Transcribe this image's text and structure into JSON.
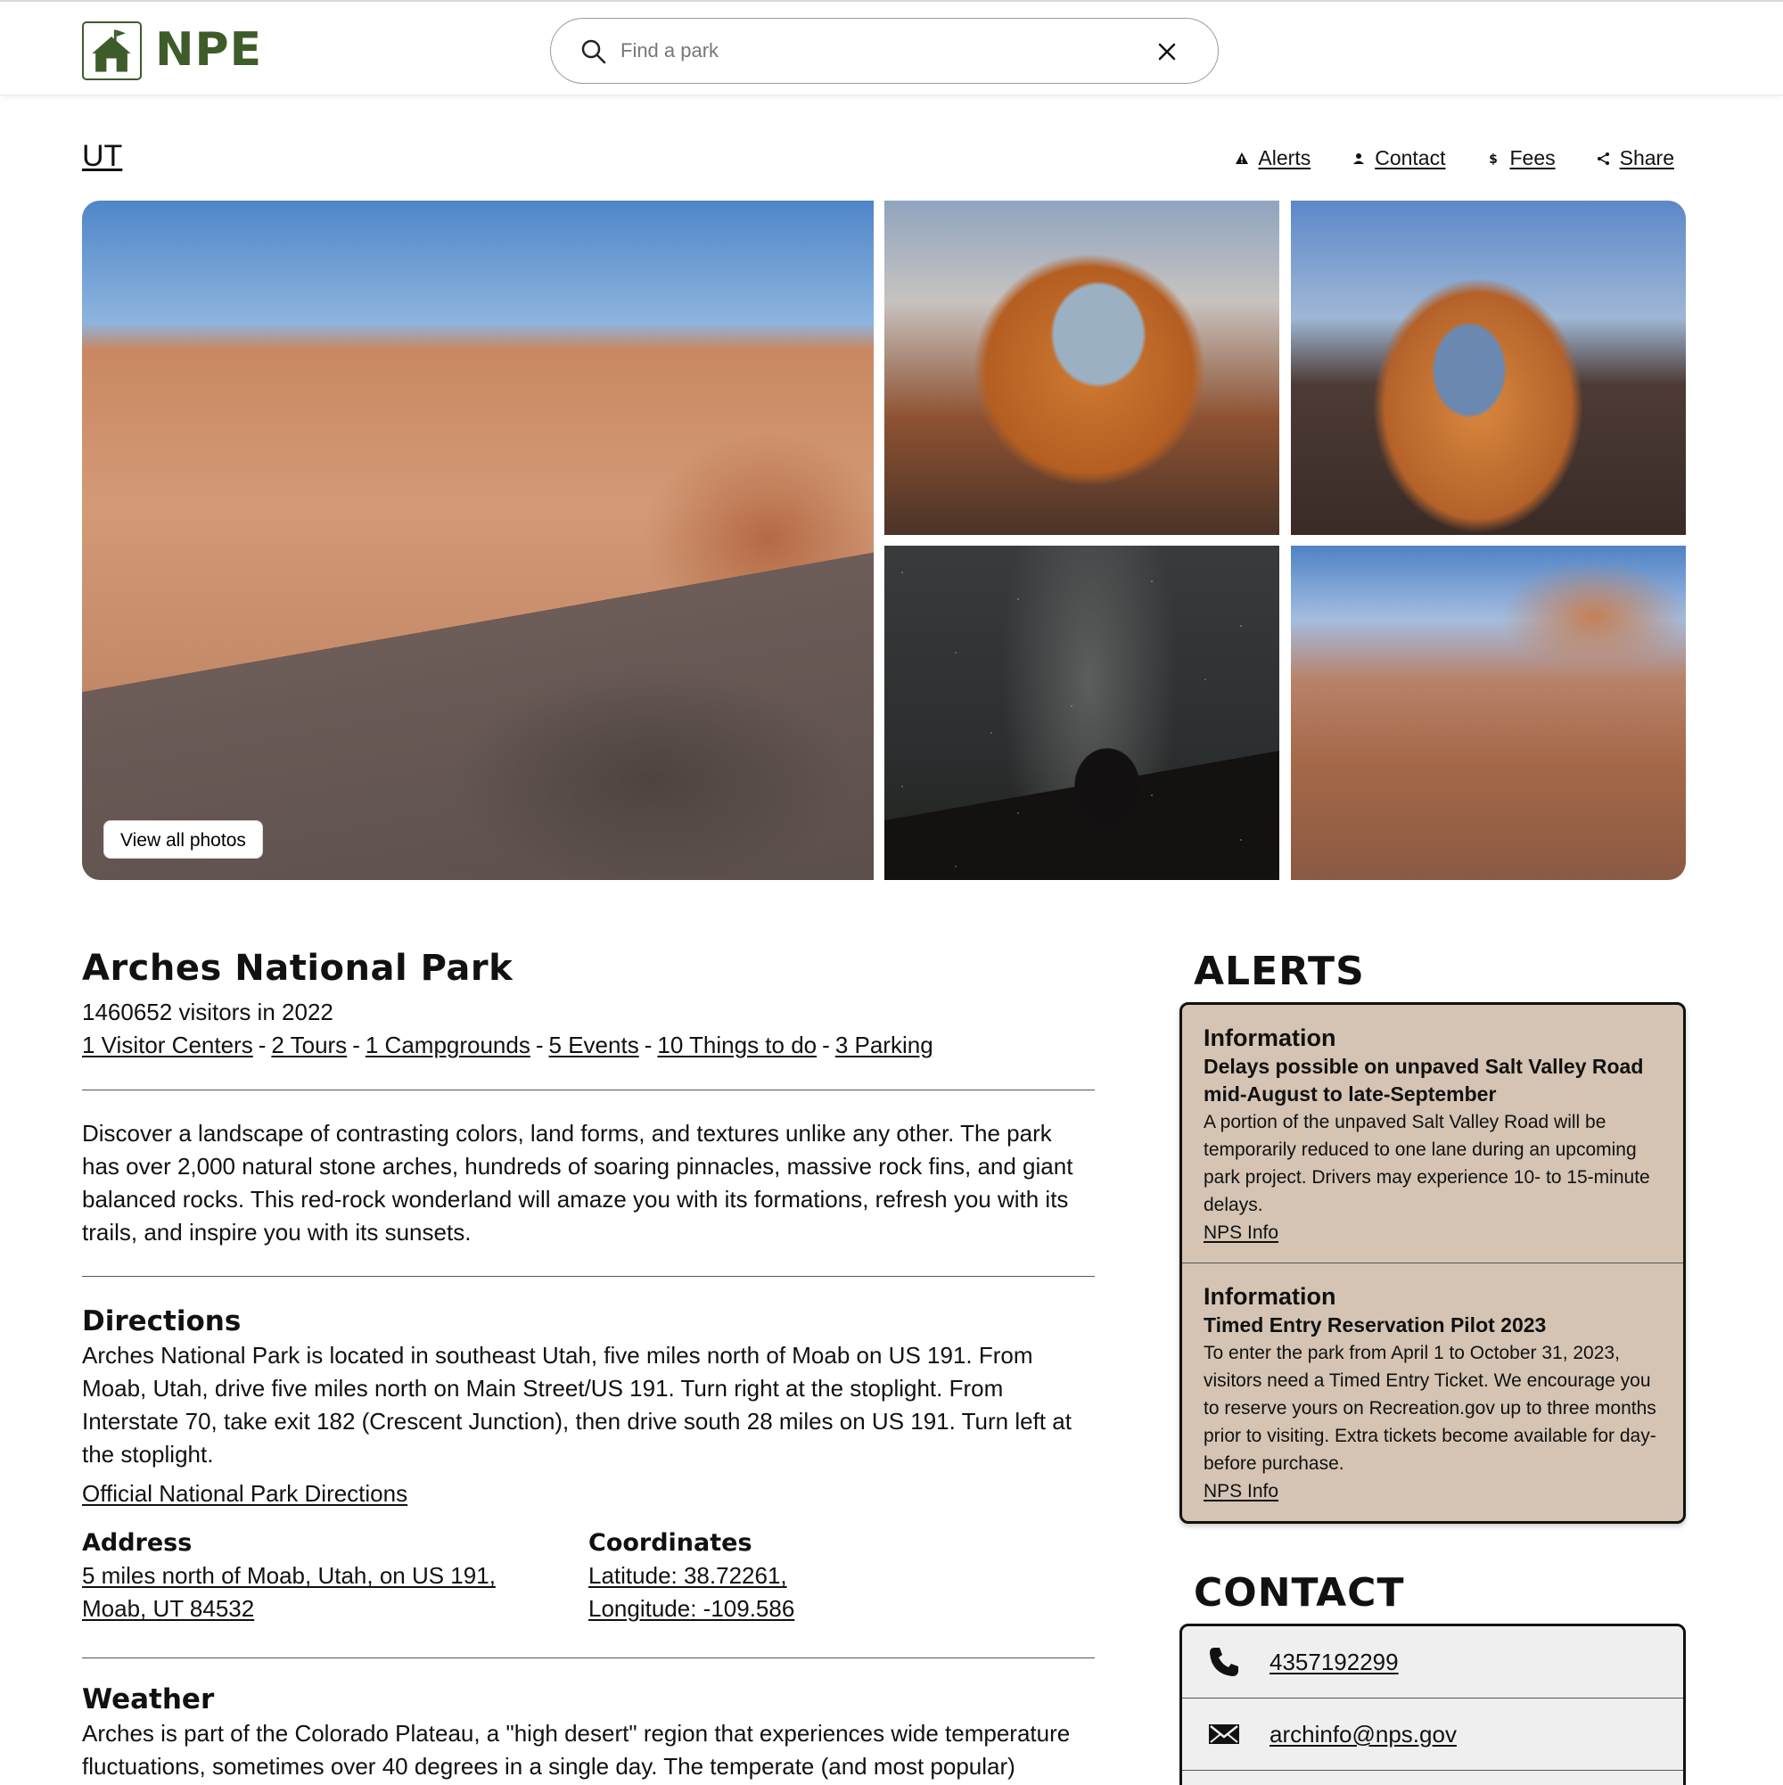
{
  "header": {
    "brand": "NPE",
    "search_placeholder": "Find a park"
  },
  "state": "UT",
  "quick_links": [
    {
      "label": "Alerts",
      "icon": "warning-icon"
    },
    {
      "label": "Contact",
      "icon": "person-icon"
    },
    {
      "label": "Fees",
      "icon": "dollar-icon"
    },
    {
      "label": "Share",
      "icon": "share-icon"
    }
  ],
  "gallery": {
    "view_all_label": "View all photos"
  },
  "park": {
    "name": "Arches National Park",
    "visitors": "1460652 visitors in 2022",
    "counts": [
      "1 Visitor Centers",
      "2 Tours",
      "1 Campgrounds",
      "5 Events",
      "10 Things to do",
      "3 Parking"
    ],
    "counts_separator": "-",
    "description": "Discover a landscape of contrasting colors, land forms, and textures unlike any other. The park has over 2,000 natural stone arches, hundreds of soaring pinnacles, massive rock fins, and giant balanced rocks. This red-rock wonderland will amaze you with its formations, refresh you with its trails, and inspire you with its sunsets."
  },
  "directions": {
    "heading": "Directions",
    "text": "Arches National Park is located in southeast Utah, five miles north of Moab on US 191. From Moab, Utah, drive five miles north on Main Street/US 191. Turn right at the stoplight. From Interstate 70, take exit 182 (Crescent Junction), then drive south 28 miles on US 191. Turn left at the stoplight.",
    "link": "Official National Park Directions",
    "address_heading": "Address",
    "address_line1": "5 miles north of Moab, Utah, on US 191,",
    "address_line2": "Moab, UT 84532",
    "coords_heading": "Coordinates",
    "latitude": "Latitude: 38.72261,",
    "longitude": "Longitude: -109.586"
  },
  "weather": {
    "heading": "Weather",
    "text": "Arches is part of the Colorado Plateau, a \"high desert\" region that experiences wide temperature fluctuations, sometimes over 40 degrees in a single day. The temperate (and most popular) seasons are spring (April-May) and fall (mid-September-October), when daytime highs average 60 to 80 F"
  },
  "alerts": {
    "heading": "ALERTS",
    "items": [
      {
        "type": "Information",
        "title": "Delays possible on unpaved Salt Valley Road mid-August to late-September",
        "text": "A portion of the unpaved Salt Valley Road will be temporarily reduced to one lane during an upcoming park project. Drivers may experience 10- to 15-minute delays.",
        "link": "NPS Info"
      },
      {
        "type": "Information",
        "title": "Timed Entry Reservation Pilot 2023",
        "text": "To enter the park from April 1 to October 31, 2023, visitors need a Timed Entry Ticket. We encourage you to reserve yours on Recreation.gov up to three months prior to visiting. Extra tickets become available for day-before purchase.",
        "link": "NPS Info"
      }
    ]
  },
  "contact": {
    "heading": "CONTACT",
    "phone": "4357192299",
    "email": "archinfo@nps.gov"
  },
  "colors": {
    "brand_green": "#3e5c2a",
    "alert_bg": "#d5c4b3",
    "contact_bg": "#efefef"
  }
}
